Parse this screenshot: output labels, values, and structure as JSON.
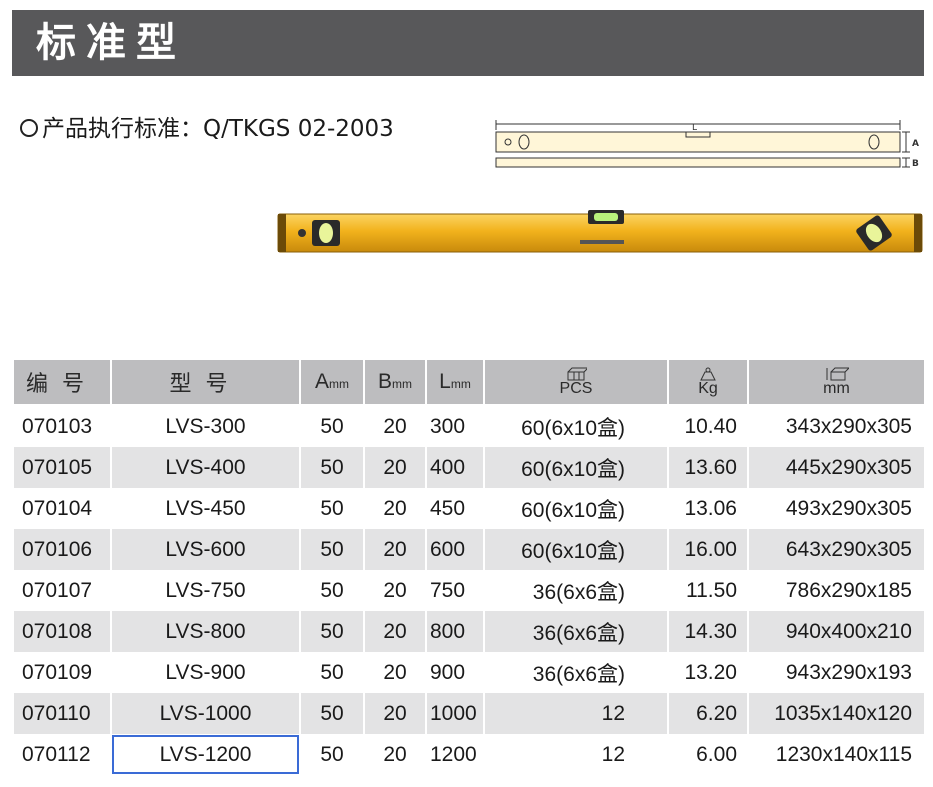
{
  "header": {
    "title": "标准型"
  },
  "standard": {
    "text": "产品执行标准：Q/TKGS 02-2003"
  },
  "diagram": {
    "label_length": "L",
    "label_a": "A",
    "label_b": "B"
  },
  "colors": {
    "title_bar": "#58585a",
    "header_row": "#bdbdbf",
    "stripe_row": "#e3e3e4",
    "level_yellow": "#f2b21c",
    "selection": "#3a6bd6"
  },
  "table": {
    "headers": {
      "code": "编号",
      "model": "型号",
      "a": "A",
      "a_unit": "mm",
      "b": "B",
      "b_unit": "mm",
      "l": "L",
      "l_unit": "mm",
      "pcs": "PCS",
      "pcs_icon": "box-stack-icon",
      "kg": "Kg",
      "kg_icon": "scale-weight-icon",
      "size": "mm",
      "size_icon": "carton-dimension-icon"
    },
    "rows": [
      {
        "code": "070103",
        "model": "LVS-300",
        "a": "50",
        "b": "20",
        "l": "300",
        "pcs": "60(6x10盒)",
        "kg": "10.40",
        "size": "343x290x305"
      },
      {
        "code": "070105",
        "model": "LVS-400",
        "a": "50",
        "b": "20",
        "l": "400",
        "pcs": "60(6x10盒)",
        "kg": "13.60",
        "size": "445x290x305"
      },
      {
        "code": "070104",
        "model": "LVS-450",
        "a": "50",
        "b": "20",
        "l": "450",
        "pcs": "60(6x10盒)",
        "kg": "13.06",
        "size": "493x290x305"
      },
      {
        "code": "070106",
        "model": "LVS-600",
        "a": "50",
        "b": "20",
        "l": "600",
        "pcs": "60(6x10盒)",
        "kg": "16.00",
        "size": "643x290x305"
      },
      {
        "code": "070107",
        "model": "LVS-750",
        "a": "50",
        "b": "20",
        "l": "750",
        "pcs": "36(6x6盒)",
        "kg": "11.50",
        "size": "786x290x185"
      },
      {
        "code": "070108",
        "model": "LVS-800",
        "a": "50",
        "b": "20",
        "l": "800",
        "pcs": "36(6x6盒)",
        "kg": "14.30",
        "size": "940x400x210"
      },
      {
        "code": "070109",
        "model": "LVS-900",
        "a": "50",
        "b": "20",
        "l": "900",
        "pcs": "36(6x6盒)",
        "kg": "13.20",
        "size": "943x290x193"
      },
      {
        "code": "070110",
        "model": "LVS-1000",
        "a": "50",
        "b": "20",
        "l": "1000",
        "pcs": "12",
        "kg": "6.20",
        "size": "1035x140x120"
      },
      {
        "code": "070112",
        "model": "LVS-1200",
        "a": "50",
        "b": "20",
        "l": "1200",
        "pcs": "12",
        "kg": "6.00",
        "size": "1230x140x115"
      }
    ]
  }
}
